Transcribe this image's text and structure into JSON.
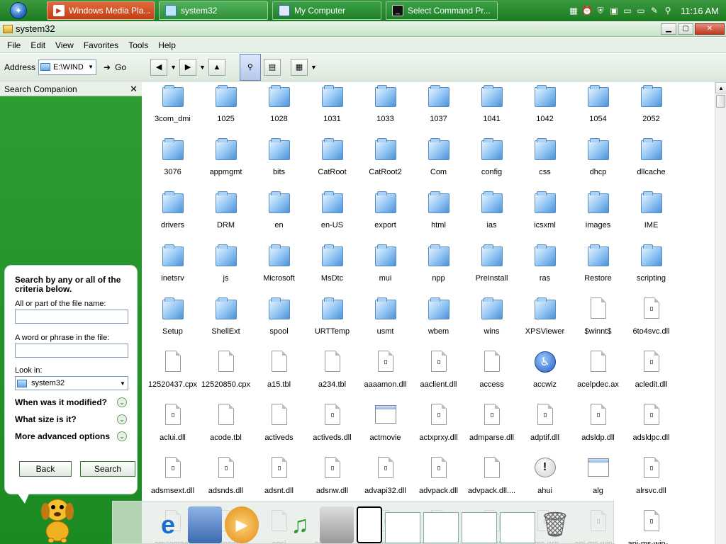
{
  "taskbar": {
    "tasks": [
      {
        "label": "Windows Media Pla..."
      },
      {
        "label": "system32"
      },
      {
        "label": "My Computer"
      },
      {
        "label": "Select Command Pr..."
      }
    ],
    "clock": "11:16 AM"
  },
  "window": {
    "title": "system32"
  },
  "menu": [
    "File",
    "Edit",
    "View",
    "Favorites",
    "Tools",
    "Help"
  ],
  "toolbar": {
    "address_label": "Address",
    "address_value": "E:\\WIND",
    "go_label": "Go"
  },
  "companion": {
    "title": "Search Companion",
    "heading": "Search by any or all of the criteria below.",
    "file_name_label": "All or part of the file name:",
    "phrase_label": "A word or phrase in the file:",
    "look_in_label": "Look in:",
    "look_in_value": "system32",
    "options": [
      "When was it modified?",
      "What size is it?",
      "More advanced options"
    ],
    "back_label": "Back",
    "search_label": "Search"
  },
  "files": [
    {
      "name": "3com_dmi",
      "type": "folder"
    },
    {
      "name": "1025",
      "type": "folder"
    },
    {
      "name": "1028",
      "type": "folder"
    },
    {
      "name": "1031",
      "type": "folder"
    },
    {
      "name": "1033",
      "type": "folder"
    },
    {
      "name": "1037",
      "type": "folder"
    },
    {
      "name": "1041",
      "type": "folder"
    },
    {
      "name": "1042",
      "type": "folder"
    },
    {
      "name": "1054",
      "type": "folder"
    },
    {
      "name": "2052",
      "type": "folder"
    },
    {
      "name": "3076",
      "type": "folder"
    },
    {
      "name": "appmgmt",
      "type": "folder"
    },
    {
      "name": "bits",
      "type": "folder"
    },
    {
      "name": "CatRoot",
      "type": "folder"
    },
    {
      "name": "CatRoot2",
      "type": "folder"
    },
    {
      "name": "Com",
      "type": "folder"
    },
    {
      "name": "config",
      "type": "folder"
    },
    {
      "name": "css",
      "type": "folder"
    },
    {
      "name": "dhcp",
      "type": "folder"
    },
    {
      "name": "dllcache",
      "type": "folder"
    },
    {
      "name": "drivers",
      "type": "folder"
    },
    {
      "name": "DRM",
      "type": "folder"
    },
    {
      "name": "en",
      "type": "folder"
    },
    {
      "name": "en-US",
      "type": "folder"
    },
    {
      "name": "export",
      "type": "folder"
    },
    {
      "name": "html",
      "type": "folder"
    },
    {
      "name": "ias",
      "type": "folder"
    },
    {
      "name": "icsxml",
      "type": "folder"
    },
    {
      "name": "images",
      "type": "folder"
    },
    {
      "name": "IME",
      "type": "folder"
    },
    {
      "name": "inetsrv",
      "type": "folder"
    },
    {
      "name": "js",
      "type": "folder"
    },
    {
      "name": "Microsoft",
      "type": "folder"
    },
    {
      "name": "MsDtc",
      "type": "folder"
    },
    {
      "name": "mui",
      "type": "folder"
    },
    {
      "name": "npp",
      "type": "folder"
    },
    {
      "name": "PreInstall",
      "type": "folder"
    },
    {
      "name": "ras",
      "type": "folder"
    },
    {
      "name": "Restore",
      "type": "folder"
    },
    {
      "name": "scripting",
      "type": "folder"
    },
    {
      "name": "Setup",
      "type": "folder"
    },
    {
      "name": "ShellExt",
      "type": "folder"
    },
    {
      "name": "spool",
      "type": "folder"
    },
    {
      "name": "URTTemp",
      "type": "folder"
    },
    {
      "name": "usmt",
      "type": "folder"
    },
    {
      "name": "wbem",
      "type": "folder"
    },
    {
      "name": "wins",
      "type": "folder"
    },
    {
      "name": "XPSViewer",
      "type": "folder"
    },
    {
      "name": "$winnt$",
      "type": "doc"
    },
    {
      "name": "6to4svc.dll",
      "type": "dll"
    },
    {
      "name": "12520437.cpx",
      "type": "doc"
    },
    {
      "name": "12520850.cpx",
      "type": "doc"
    },
    {
      "name": "a15.tbl",
      "type": "doc"
    },
    {
      "name": "a234.tbl",
      "type": "doc"
    },
    {
      "name": "aaaamon.dll",
      "type": "dll"
    },
    {
      "name": "aaclient.dll",
      "type": "dll"
    },
    {
      "name": "access",
      "type": "doc"
    },
    {
      "name": "accwiz",
      "type": "accessibility"
    },
    {
      "name": "acelpdec.ax",
      "type": "doc"
    },
    {
      "name": "acledit.dll",
      "type": "dll"
    },
    {
      "name": "aclui.dll",
      "type": "dll"
    },
    {
      "name": "acode.tbl",
      "type": "doc"
    },
    {
      "name": "activeds",
      "type": "doc"
    },
    {
      "name": "activeds.dll",
      "type": "dll"
    },
    {
      "name": "actmovie",
      "type": "app"
    },
    {
      "name": "actxprxy.dll",
      "type": "dll"
    },
    {
      "name": "admparse.dll",
      "type": "dll"
    },
    {
      "name": "adptif.dll",
      "type": "dll"
    },
    {
      "name": "adsldp.dll",
      "type": "dll"
    },
    {
      "name": "adsldpc.dll",
      "type": "dll"
    },
    {
      "name": "adsmsext.dll",
      "type": "dll"
    },
    {
      "name": "adsnds.dll",
      "type": "dll"
    },
    {
      "name": "adsnt.dll",
      "type": "dll"
    },
    {
      "name": "adsnw.dll",
      "type": "dll"
    },
    {
      "name": "advapi32.dll",
      "type": "dll"
    },
    {
      "name": "advpack.dll",
      "type": "dll"
    },
    {
      "name": "advpack.dll....",
      "type": "doc"
    },
    {
      "name": "ahui",
      "type": "help"
    },
    {
      "name": "alg",
      "type": "app"
    },
    {
      "name": "alrsvc.dll",
      "type": "dll"
    },
    {
      "name": "amcompat",
      "type": "doc"
    },
    {
      "name": "amstream.dll",
      "type": "dll"
    },
    {
      "name": "ansi",
      "type": "doc"
    },
    {
      "name": "apcups.dll",
      "type": "dll"
    },
    {
      "name": "api-ms-win-...",
      "type": "dll"
    },
    {
      "name": "api-ms-win-...",
      "type": "dll"
    },
    {
      "name": "api-ms-win-...",
      "type": "dll"
    },
    {
      "name": "api-ms-win-...",
      "type": "dll"
    },
    {
      "name": "api-ms-win-...",
      "type": "dll"
    },
    {
      "name": "api-ms-win-...",
      "type": "dll"
    }
  ]
}
